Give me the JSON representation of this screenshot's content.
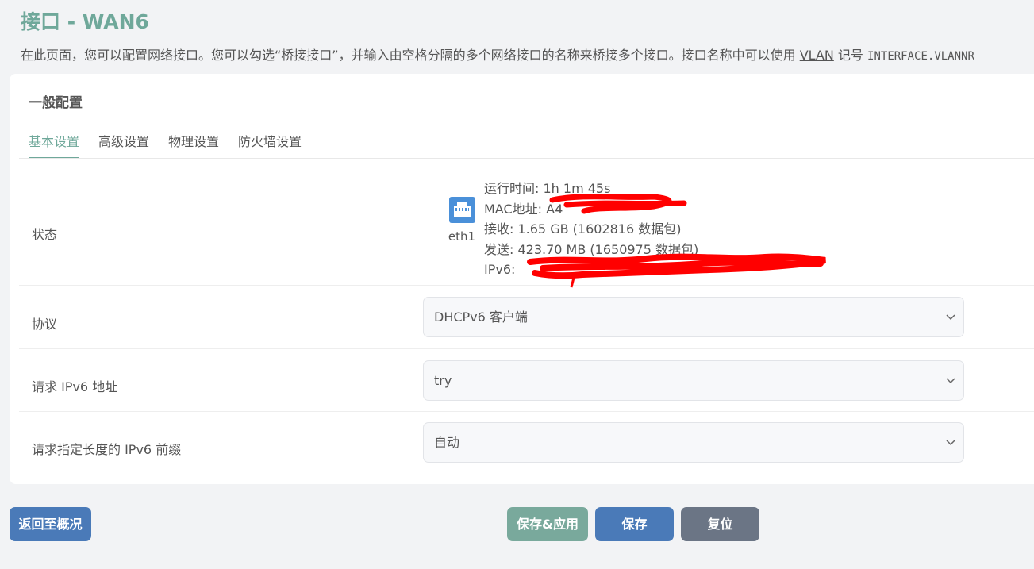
{
  "page": {
    "title": "接口 - WAN6",
    "desc_before": "在此页面，您可以配置网络接口。您可以勾选“桥接接口”，并输入由空格分隔的多个网络接口的名称来桥接多个接口。接口名称中可以使用",
    "desc_link": "VLAN",
    "desc_mid": "记号",
    "desc_code": "INTERFACE.VLANNR"
  },
  "section": {
    "title": "一般配置",
    "tabs": [
      {
        "label": "基本设置",
        "active": true
      },
      {
        "label": "高级设置",
        "active": false
      },
      {
        "label": "物理设置",
        "active": false
      },
      {
        "label": "防火墙设置",
        "active": false
      }
    ]
  },
  "status": {
    "label": "状态",
    "iface": "eth1",
    "icon": "ethernet-port-icon",
    "uptime": "运行时间: 1h 1m 45s",
    "mac": "MAC地址: A4",
    "rx": "接收: 1.65 GB (1602816 数据包)",
    "tx": "发送: 423.70 MB (1650975 数据包)",
    "ipv6": "IPv6:"
  },
  "fields": {
    "protocol": {
      "label": "协议",
      "value": "DHCPv6 客户端"
    },
    "request_ipv6": {
      "label": "请求 IPv6 地址",
      "value": "try"
    },
    "prefix_len": {
      "label": "请求指定长度的 IPv6 前缀",
      "value": "自动"
    }
  },
  "buttons": {
    "back": "返回至概况",
    "save_apply": "保存&应用",
    "save": "保存",
    "reset": "复位"
  },
  "colors": {
    "accent": "#6fa89a",
    "primary": "#4a7ab8",
    "save_apply": "#79a99c",
    "reset": "#6b7585",
    "icon": "#4a90d9",
    "redaction": "#ff0000"
  }
}
